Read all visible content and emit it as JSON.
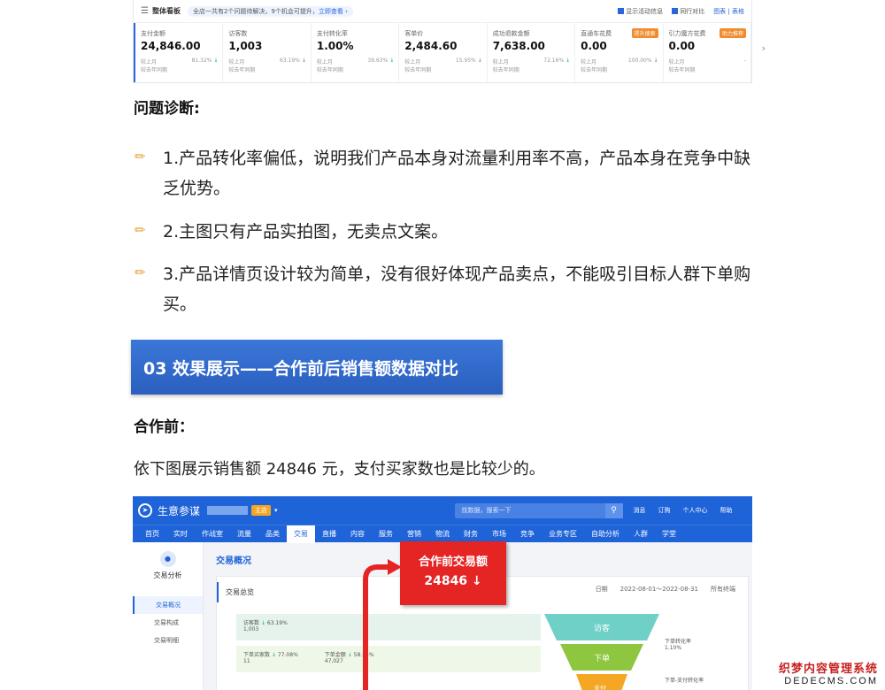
{
  "dashboard": {
    "title": "整体看板",
    "notice": "全店一共有2个问题待解决，9个机会可提升，",
    "notice_link": "立即查看",
    "options": [
      "显示活动信息",
      "同行对比"
    ],
    "view_links": "图表 | 表格",
    "metrics": [
      {
        "name": "支付金额",
        "value": "24,846.00",
        "cmp1": "较上月",
        "pct": "81.32%",
        "cmp2": "较去年同期",
        "tag": ""
      },
      {
        "name": "访客数",
        "value": "1,003",
        "cmp1": "较上月",
        "pct": "63.19%",
        "cmp2": "较去年同期",
        "tag": ""
      },
      {
        "name": "支付转化率",
        "value": "1.00%",
        "cmp1": "较上月",
        "pct": "39.63%",
        "cmp2": "较去年同期",
        "tag": ""
      },
      {
        "name": "客单价",
        "value": "2,484.60",
        "cmp1": "较上月",
        "pct": "15.95%",
        "cmp2": "较去年同期",
        "tag": ""
      },
      {
        "name": "成功退款金额",
        "value": "7,638.00",
        "cmp1": "较上月",
        "pct": "72.16%",
        "cmp2": "较去年同期",
        "tag": ""
      },
      {
        "name": "直通车花费",
        "value": "0.00",
        "cmp1": "较上月",
        "pct": "100.00%",
        "cmp2": "较去年同期",
        "tag": "提升搜索"
      },
      {
        "name": "引力魔方花费",
        "value": "0.00",
        "cmp1": "较上月",
        "pct": "-",
        "cmp2": "较去年同期",
        "tag": "助力推荐"
      }
    ]
  },
  "article": {
    "diagnosis_heading": "问题诊断:",
    "items": [
      "1.产品转化率偏低，说明我们产品本身对流量利用率不高，产品本身在竞争中缺乏优势。",
      "2.主图只有产品实拍图，无卖点文案。",
      "3.产品详情页设计较为简单，没有很好体现产品卖点，不能吸引目标人群下单购买。"
    ],
    "banner": "03 效果展示——合作前后销售额数据对比",
    "before_heading": "合作前：",
    "before_text": "依下图展示销售额 24846 元，支付买家数也是比较少的。"
  },
  "shot": {
    "brand": "生意参谋",
    "shop_badge": "主店",
    "search_placeholder": "找数据，搜索一下",
    "top_links": [
      "消息",
      "订购",
      "个人中心",
      "帮助"
    ],
    "nav": [
      "首页",
      "实时",
      "作战室",
      "流量",
      "品类",
      "交易",
      "直播",
      "内容",
      "服务",
      "营销",
      "物流",
      "财务",
      "市场",
      "竞争",
      "业务专区",
      "自助分析",
      "人群",
      "学堂"
    ],
    "active_nav": "交易",
    "side_title": "交易分析",
    "side_items": [
      "交易概况",
      "交易构成",
      "交易明细"
    ],
    "page_title": "交易概况",
    "panel_title": "交易总览",
    "filters": [
      "日期",
      "2022-08-01～2022-08-31",
      "所有终端"
    ],
    "row1": {
      "label": "访客数",
      "pct": "63.19%",
      "value": "1,003"
    },
    "row2": [
      {
        "label": "下单买家数",
        "pct": "77.08%",
        "value": "11"
      },
      {
        "label": "下单金额",
        "pct": "58.55%",
        "value": "47,027"
      }
    ],
    "funnel": [
      "访客",
      "下单",
      "支付"
    ],
    "funnel_labels": [
      {
        "label": "下单转化率",
        "value": "1.10%"
      },
      {
        "label": "下单-支付转化率",
        "value": ""
      }
    ],
    "callout_title": "合作前交易额",
    "callout_value": "24846 ↓"
  },
  "watermark": {
    "line1": "织梦内容管理系统",
    "line2": "DEDECMS.COM"
  },
  "colors": {
    "accent": "#1f63d8",
    "banner": "#2f6ccb",
    "callout": "#e52424",
    "arrow": "#e52424"
  }
}
